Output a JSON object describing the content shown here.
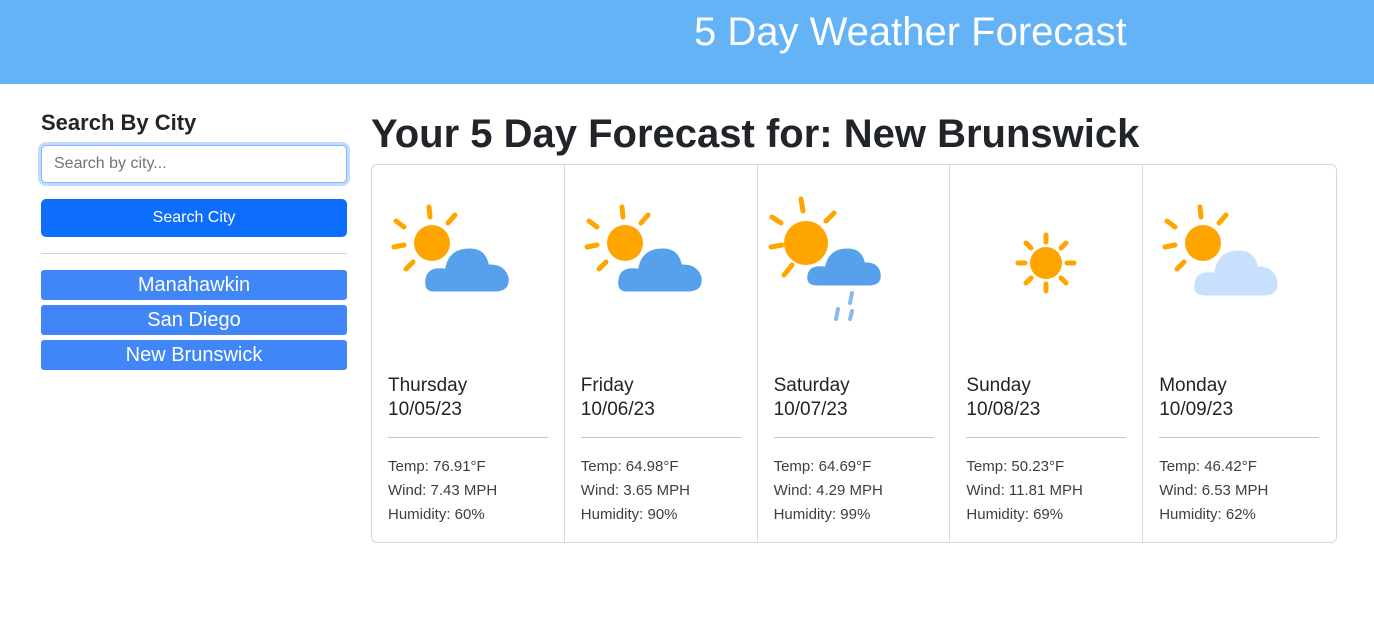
{
  "header": {
    "title": "5 Day Weather Forecast"
  },
  "sidebar": {
    "heading": "Search By City",
    "search_placeholder": "Search by city...",
    "search_button": "Search City",
    "history": [
      "Manahawkin",
      "San Diego",
      "New Brunswick"
    ]
  },
  "forecast": {
    "title": "Your 5 Day Forecast for: New Brunswick",
    "days": [
      {
        "day": "Thursday",
        "date": "10/05/23",
        "temp": "Temp: 76.91°F",
        "wind": "Wind: 7.43 MPH",
        "humidity": "Humidity: 60%",
        "icon": "partly-cloudy-icon"
      },
      {
        "day": "Friday",
        "date": "10/06/23",
        "temp": "Temp: 64.98°F",
        "wind": "Wind: 3.65 MPH",
        "humidity": "Humidity: 90%",
        "icon": "partly-cloudy-icon"
      },
      {
        "day": "Saturday",
        "date": "10/07/23",
        "temp": "Temp: 64.69°F",
        "wind": "Wind: 4.29 MPH",
        "humidity": "Humidity: 99%",
        "icon": "sun-rain-icon"
      },
      {
        "day": "Sunday",
        "date": "10/08/23",
        "temp": "Temp: 50.23°F",
        "wind": "Wind: 11.81 MPH",
        "humidity": "Humidity: 69%",
        "icon": "sun-icon"
      },
      {
        "day": "Monday",
        "date": "10/09/23",
        "temp": "Temp: 46.42°F",
        "wind": "Wind: 6.53 MPH",
        "humidity": "Humidity: 62%",
        "icon": "light-cloud-icon"
      }
    ]
  },
  "colors": {
    "header_bg": "#63b3f6",
    "primary": "#0d6efd",
    "history_button": "#4186f6",
    "sun": "#ffa500",
    "cloud": "#56a0ec",
    "light_cloud": "#c9e0fd"
  }
}
